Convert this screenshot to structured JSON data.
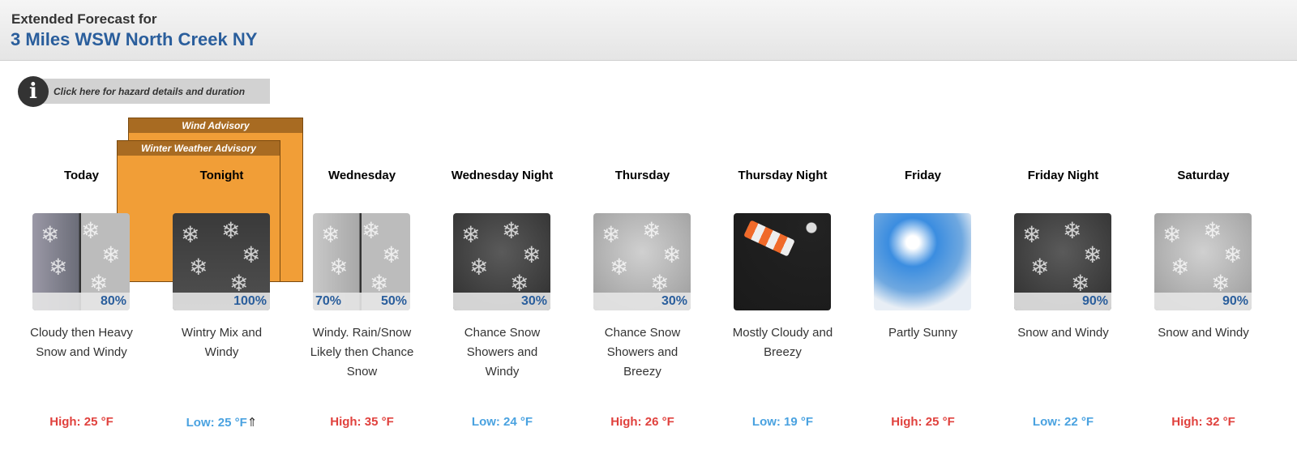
{
  "header": {
    "subtitle": "Extended Forecast for",
    "location": "3 Miles WSW North Creek NY"
  },
  "hazard_button": {
    "icon": "info-icon",
    "label": "Click here for hazard details and duration"
  },
  "advisories": [
    {
      "label": "Wind Advisory",
      "color": "#f19e37"
    },
    {
      "label": "Winter Weather Advisory",
      "color": "#f19e37"
    }
  ],
  "colors": {
    "high": "#e0413d",
    "low": "#4aa2e0",
    "accent": "#2a5e9c"
  },
  "periods": [
    {
      "name": "Today",
      "desc": "Cloudy then Heavy Snow and Windy",
      "pop": "80%",
      "temp": "High: 25 °F",
      "type": "hi",
      "img": "cloudy-snow"
    },
    {
      "name": "Tonight",
      "desc": "Wintry Mix and Windy",
      "pop": "100%",
      "temp": "Low: 25 °F",
      "extra": "⇑",
      "type": "lo",
      "img": "wintry-mix"
    },
    {
      "name": "Wednesday",
      "desc": "Windy. Rain/Snow Likely then Chance Snow",
      "pop": "50%",
      "pop2": "70%",
      "temp": "High: 35 °F",
      "type": "hi",
      "img": "rain-snow"
    },
    {
      "name": "Wednesday Night",
      "desc": "Chance Snow Showers and Windy",
      "pop": "30%",
      "temp": "Low: 24 °F",
      "type": "lo",
      "img": "snow-night"
    },
    {
      "name": "Thursday",
      "desc": "Chance Snow Showers and Breezy",
      "pop": "30%",
      "temp": "High: 26 °F",
      "type": "hi",
      "img": "snow-day"
    },
    {
      "name": "Thursday Night",
      "desc": "Mostly Cloudy and Breezy",
      "pop": "",
      "temp": "Low: 19 °F",
      "type": "lo",
      "img": "windsock-night"
    },
    {
      "name": "Friday",
      "desc": "Partly Sunny",
      "pop": "",
      "temp": "High: 25 °F",
      "type": "hi",
      "img": "partly-sunny"
    },
    {
      "name": "Friday Night",
      "desc": "Snow and Windy",
      "pop": "90%",
      "temp": "Low: 22 °F",
      "type": "lo",
      "img": "snow-night"
    },
    {
      "name": "Saturday",
      "desc": "Snow and Windy",
      "pop": "90%",
      "temp": "High: 32 °F",
      "type": "hi",
      "img": "snow-day"
    }
  ]
}
